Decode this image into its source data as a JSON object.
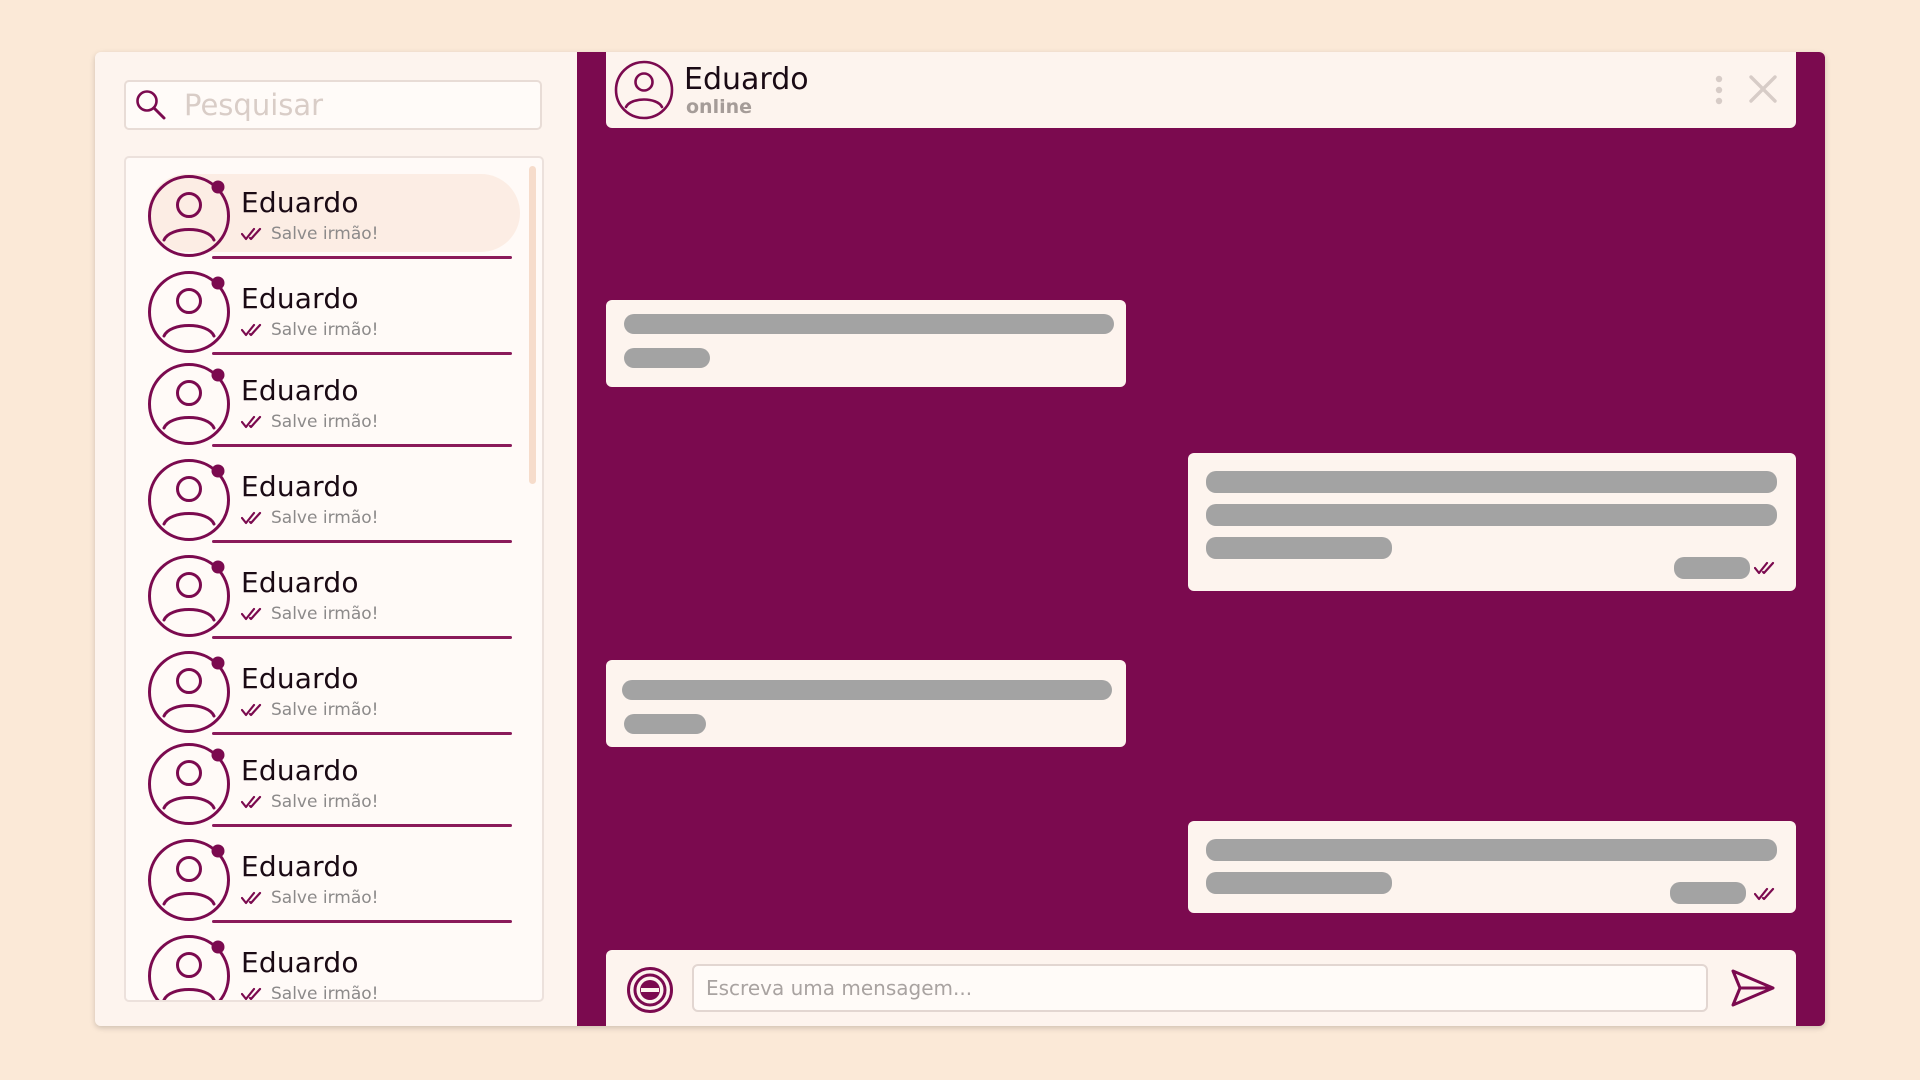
{
  "search": {
    "placeholder": "Pesquisar"
  },
  "contacts": [
    {
      "name": "Eduardo",
      "preview": "Salve irmão!"
    },
    {
      "name": "Eduardo",
      "preview": "Salve irmão!"
    },
    {
      "name": "Eduardo",
      "preview": "Salve irmão!"
    },
    {
      "name": "Eduardo",
      "preview": "Salve irmão!"
    },
    {
      "name": "Eduardo",
      "preview": "Salve irmão!"
    },
    {
      "name": "Eduardo",
      "preview": "Salve irmão!"
    },
    {
      "name": "Eduardo",
      "preview": "Salve irmão!"
    },
    {
      "name": "Eduardo",
      "preview": "Salve irmão!"
    },
    {
      "name": "Eduardo",
      "preview": "Salve irmão!"
    }
  ],
  "chat": {
    "contact_name": "Eduardo",
    "status": "online"
  },
  "composer": {
    "placeholder": "Escreva uma mensagem..."
  },
  "colors": {
    "accent": "#7b0a4f",
    "background": "#fbe9d7",
    "panel": "#fdf4ee",
    "placeholder_bar": "#a3a3a3"
  },
  "icons": {
    "search": "search-icon",
    "avatar": "user-avatar-icon",
    "read": "double-check-icon",
    "menu": "vertical-dots-icon",
    "close": "close-icon",
    "attach": "attach-icon",
    "send": "send-icon"
  }
}
